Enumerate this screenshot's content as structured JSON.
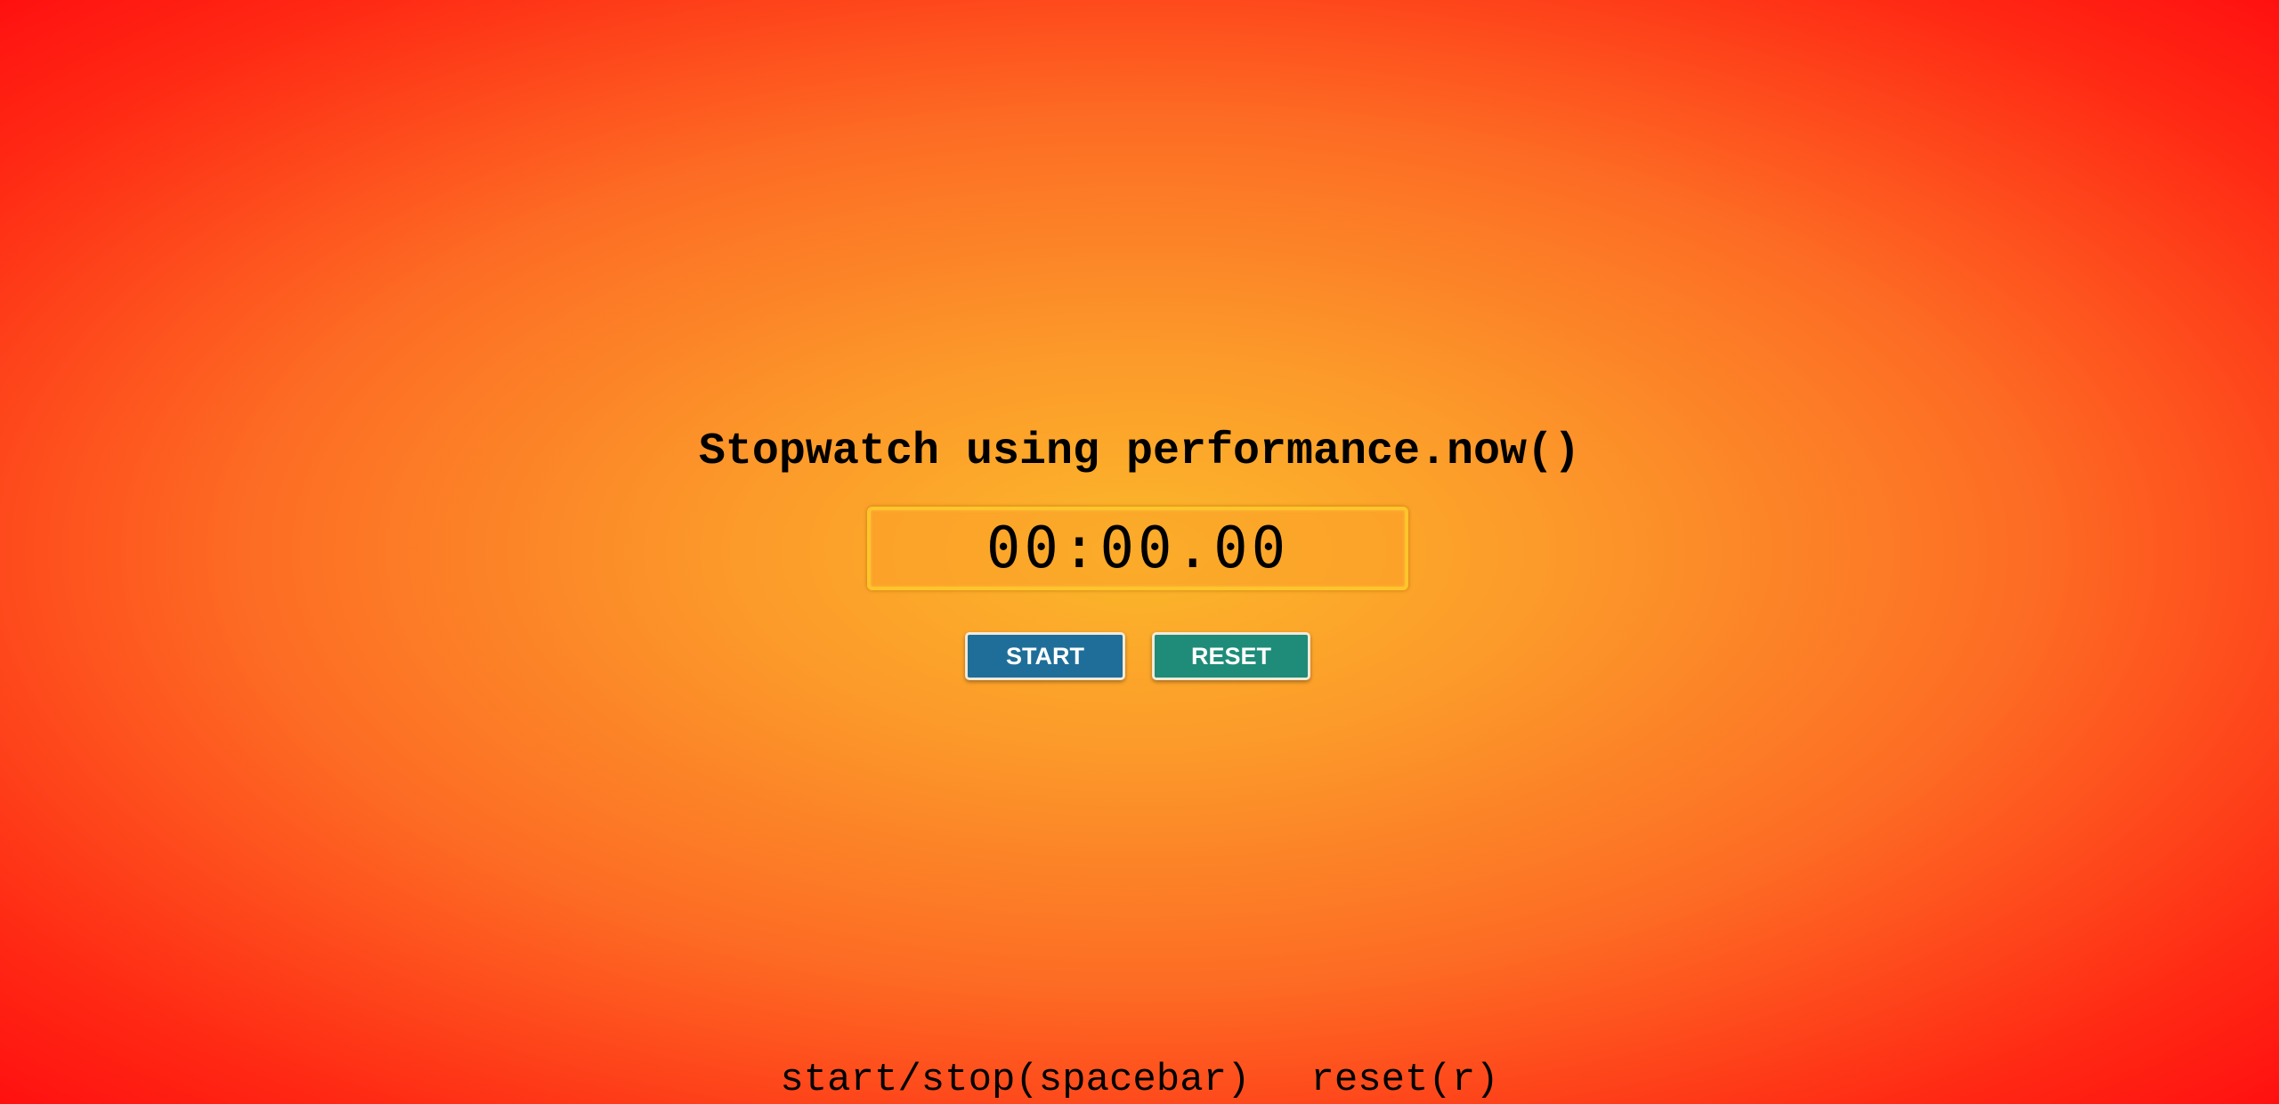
{
  "app": {
    "title": "Stopwatch using performance.now()"
  },
  "display": {
    "time": "00:00.00"
  },
  "controls": {
    "start_label": "START",
    "reset_label": "RESET"
  },
  "hints": {
    "start_stop": "start/stop(spacebar)",
    "reset": "reset(r)"
  },
  "colors": {
    "start_button": "#1f6e9a",
    "reset_button": "#1e8c78",
    "display_border": "#ffc52a",
    "background_center": "#fbb82a",
    "background_edge": "#ff1010"
  }
}
